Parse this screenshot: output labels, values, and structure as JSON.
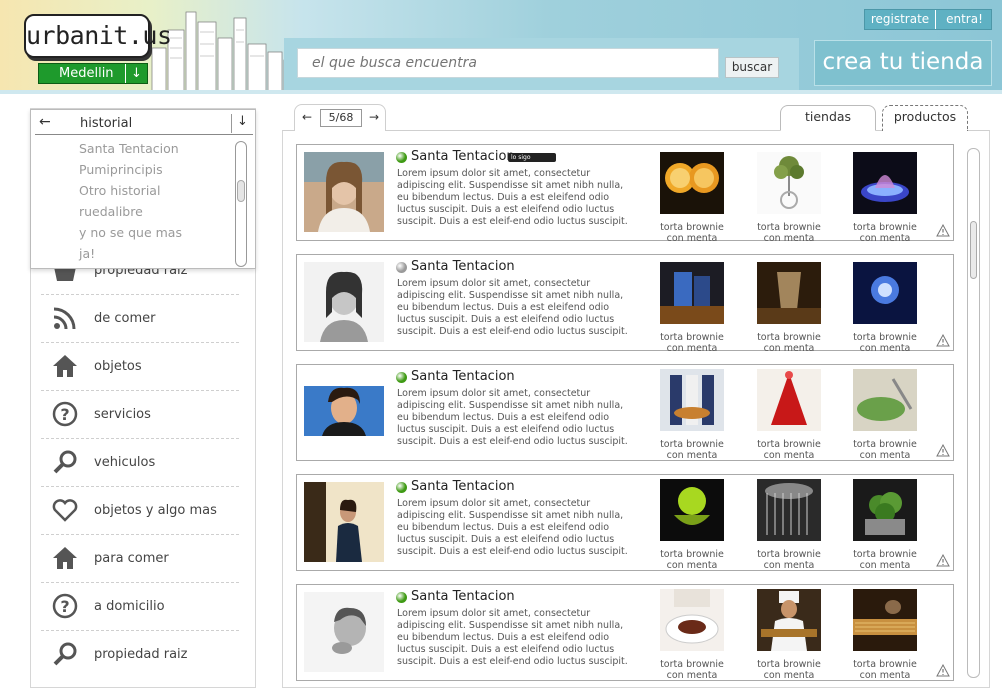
{
  "header": {
    "logo": "urbanit.us",
    "city": "Medellin",
    "search_placeholder": "el que busca encuentra",
    "search_button": "buscar",
    "create_store": "crea tu tienda",
    "register": "registrate",
    "login": "entra!"
  },
  "dropdown": {
    "current": "historial",
    "items": [
      "Santa Tentacion",
      "Pumiprincipis",
      "Otro historial",
      "ruedalibre",
      "y no se que mas",
      "ja!"
    ]
  },
  "sidebar": {
    "items": [
      {
        "label": "propiedad raiz",
        "icon": "basket-icon"
      },
      {
        "label": "de comer",
        "icon": "rss-icon"
      },
      {
        "label": "objetos",
        "icon": "home-icon"
      },
      {
        "label": "servicios",
        "icon": "question-icon"
      },
      {
        "label": "vehiculos",
        "icon": "search-icon"
      },
      {
        "label": "objetos y algo mas",
        "icon": "heart-icon"
      },
      {
        "label": "para comer",
        "icon": "home-icon"
      },
      {
        "label": "a domicilio",
        "icon": "question-icon"
      },
      {
        "label": "propiedad raiz",
        "icon": "search-icon"
      }
    ]
  },
  "pager": {
    "current": "5/68"
  },
  "tabs": {
    "stores": "tiendas",
    "products": "productos"
  },
  "store_cards": [
    {
      "name": "Santa Tentacion",
      "badge": "lo sigo",
      "status": "online",
      "status_color": "#3f9a14",
      "description": "Lorem ipsum dolor sit amet, consectetur adipiscing elit. Suspendisse sit amet nibh nulla, eu bibendum lectus. Duis a est eleifend odio luctus suscipit. Duis a est eleifend odio luctus suscipit. Duis a est eleif-end odio luctus suscipit.",
      "products": [
        {
          "caption_1": "torta brownie",
          "caption_2": "con menta"
        },
        {
          "caption_1": "torta brownie",
          "caption_2": "con menta"
        },
        {
          "caption_1": "torta brownie",
          "caption_2": "con menta"
        }
      ]
    },
    {
      "name": "Santa Tentacion",
      "badge": "",
      "status": "offline",
      "status_color": "#9a9a9a",
      "description": "Lorem ipsum dolor sit amet, consectetur adipiscing elit. Suspendisse sit amet nibh nulla, eu bibendum lectus. Duis a est eleifend odio luctus suscipit. Duis a est eleifend odio luctus suscipit. Duis a est eleif-end odio luctus suscipit.",
      "products": [
        {
          "caption_1": "torta brownie",
          "caption_2": "con menta"
        },
        {
          "caption_1": "torta brownie",
          "caption_2": "con menta"
        },
        {
          "caption_1": "torta brownie",
          "caption_2": "con menta"
        }
      ]
    },
    {
      "name": "Santa Tentacion",
      "badge": "",
      "status": "online",
      "status_color": "#3f9a14",
      "description": "Lorem ipsum dolor sit amet, consectetur adipiscing elit. Suspendisse sit amet nibh nulla, eu bibendum lectus. Duis a est eleifend odio luctus suscipit. Duis a est eleifend odio luctus suscipit. Duis a est eleif-end odio luctus suscipit.",
      "products": [
        {
          "caption_1": "torta brownie",
          "caption_2": "con menta"
        },
        {
          "caption_1": "torta brownie",
          "caption_2": "con menta"
        },
        {
          "caption_1": "torta brownie",
          "caption_2": "con menta"
        }
      ]
    },
    {
      "name": "Santa Tentacion",
      "badge": "",
      "status": "online",
      "status_color": "#3f9a14",
      "description": "Lorem ipsum dolor sit amet, consectetur adipiscing elit. Suspendisse sit amet nibh nulla, eu bibendum lectus. Duis a est eleifend odio luctus suscipit. Duis a est eleifend odio luctus suscipit. Duis a est eleif-end odio luctus suscipit.",
      "products": [
        {
          "caption_1": "torta brownie",
          "caption_2": "con menta"
        },
        {
          "caption_1": "torta brownie",
          "caption_2": "con menta"
        },
        {
          "caption_1": "torta brownie",
          "caption_2": "con menta"
        }
      ]
    },
    {
      "name": "Santa Tentacion",
      "badge": "",
      "status": "online",
      "status_color": "#3f9a14",
      "description": "Lorem ipsum dolor sit amet, consectetur adipiscing elit. Suspendisse sit amet nibh nulla, eu bibendum lectus. Duis a est eleifend odio luctus suscipit. Duis a est eleifend odio luctus suscipit. Duis a est eleif-end odio luctus suscipit.",
      "products": [
        {
          "caption_1": "torta brownie",
          "caption_2": "con menta"
        },
        {
          "caption_1": "torta brownie",
          "caption_2": "con menta"
        },
        {
          "caption_1": "torta brownie",
          "caption_2": "con menta"
        }
      ]
    }
  ]
}
